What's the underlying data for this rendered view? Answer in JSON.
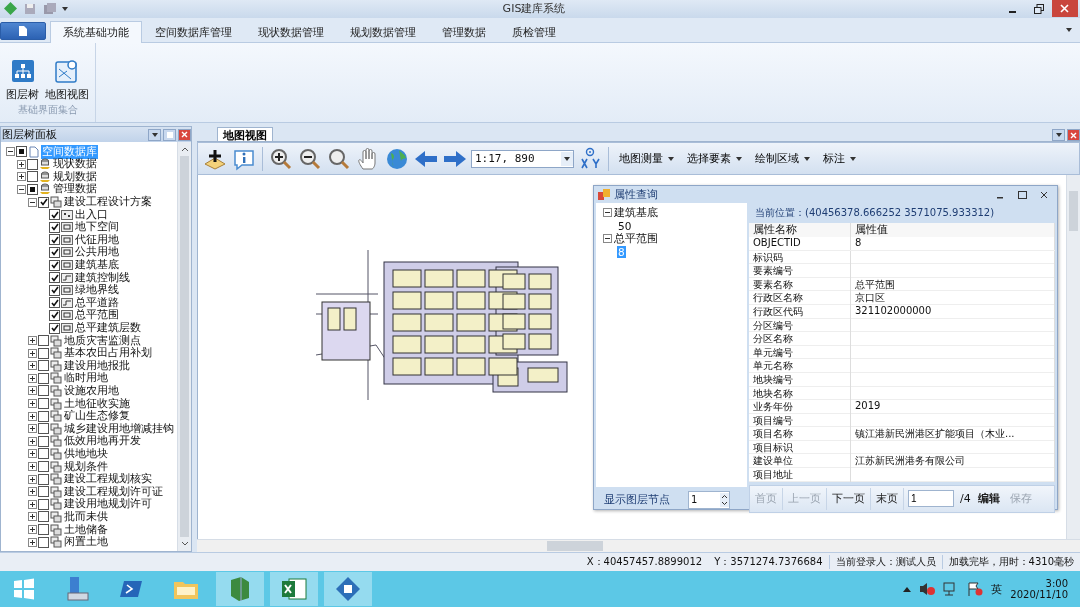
{
  "window": {
    "title": "GIS建库系统"
  },
  "ribbon": {
    "tabs": [
      {
        "label": "系统基础功能",
        "selected": true
      },
      {
        "label": "空间数据库管理",
        "selected": false
      },
      {
        "label": "现状数据管理",
        "selected": false
      },
      {
        "label": "规划数据管理",
        "selected": false
      },
      {
        "label": "管理数据",
        "selected": false
      },
      {
        "label": "质检管理",
        "selected": false
      }
    ],
    "group": {
      "label": "基础界面集合",
      "buttons": [
        {
          "label": "图层树",
          "kind": "tree"
        },
        {
          "label": "地图视图",
          "kind": "map"
        }
      ]
    }
  },
  "layer_panel": {
    "title": "图层树面板",
    "tree": [
      {
        "label": "空间数据库",
        "kind": "root",
        "partial": true,
        "expanded": true,
        "selected": true,
        "children": [
          {
            "label": "现状数据",
            "kind": "database",
            "checked": false,
            "expanded": false,
            "selected": false
          },
          {
            "label": "规划数据",
            "kind": "database",
            "checked": false,
            "expanded": false,
            "selected": false
          },
          {
            "label": "管理数据",
            "kind": "database",
            "partial": true,
            "expanded": true,
            "selected": false,
            "children": [
              {
                "label": "建设工程设计方案",
                "kind": "group",
                "checked": true,
                "expanded": true,
                "selected": false,
                "children": [
                  {
                    "label": "出入口",
                    "kind": "point",
                    "checked": true,
                    "selected": false
                  },
                  {
                    "label": "地下空间",
                    "kind": "polygon",
                    "checked": true,
                    "selected": false
                  },
                  {
                    "label": "代征用地",
                    "kind": "polygon",
                    "checked": true,
                    "selected": false
                  },
                  {
                    "label": "公共用地",
                    "kind": "polygon",
                    "checked": true,
                    "selected": false
                  },
                  {
                    "label": "建筑基底",
                    "kind": "polygon",
                    "checked": true,
                    "selected": false
                  },
                  {
                    "label": "建筑控制线",
                    "kind": "line",
                    "checked": true,
                    "selected": false
                  },
                  {
                    "label": "绿地界线",
                    "kind": "polygon",
                    "checked": true,
                    "selected": false
                  },
                  {
                    "label": "总平道路",
                    "kind": "line",
                    "checked": true,
                    "selected": false
                  },
                  {
                    "label": "总平范围",
                    "kind": "polygon",
                    "checked": true,
                    "selected": false
                  },
                  {
                    "label": "总平建筑层数",
                    "kind": "polygon",
                    "checked": true,
                    "selected": false
                  }
                ]
              },
              {
                "label": "地质灾害监测点",
                "kind": "group",
                "checked": false,
                "expanded": false,
                "selected": false
              },
              {
                "label": "基本农田占用补划",
                "kind": "group",
                "checked": false,
                "expanded": false,
                "selected": false
              },
              {
                "label": "建设用地报批",
                "kind": "group",
                "checked": false,
                "expanded": false,
                "selected": false
              },
              {
                "label": "临时用地",
                "kind": "group",
                "checked": false,
                "expanded": false,
                "selected": false
              },
              {
                "label": "设施农用地",
                "kind": "group",
                "checked": false,
                "expanded": false,
                "selected": false
              },
              {
                "label": "土地征收实施",
                "kind": "group",
                "checked": false,
                "expanded": false,
                "selected": false
              },
              {
                "label": "矿山生态修复",
                "kind": "group",
                "checked": false,
                "expanded": false,
                "selected": false
              },
              {
                "label": "城乡建设用地增减挂钩",
                "kind": "group",
                "checked": false,
                "expanded": false,
                "selected": false
              },
              {
                "label": "低效用地再开发",
                "kind": "group",
                "checked": false,
                "expanded": false,
                "selected": false
              },
              {
                "label": "供地地块",
                "kind": "group",
                "checked": false,
                "expanded": false,
                "selected": false
              },
              {
                "label": "规划条件",
                "kind": "group",
                "checked": false,
                "expanded": false,
                "selected": false
              },
              {
                "label": "建设工程规划核实",
                "kind": "group",
                "checked": false,
                "expanded": false,
                "selected": false
              },
              {
                "label": "建设工程规划许可证",
                "kind": "group",
                "checked": false,
                "expanded": false,
                "selected": false
              },
              {
                "label": "建设用地规划许可",
                "kind": "group",
                "checked": false,
                "expanded": false,
                "selected": false
              },
              {
                "label": "批而未供",
                "kind": "group",
                "checked": false,
                "expanded": false,
                "selected": false
              },
              {
                "label": "土地储备",
                "kind": "group",
                "checked": false,
                "expanded": false,
                "selected": false
              },
              {
                "label": "闲置土地",
                "kind": "group",
                "checked": false,
                "expanded": false,
                "selected": false
              }
            ]
          }
        ]
      }
    ]
  },
  "map_view": {
    "tab": "地图视图",
    "scale": "1:17, 890",
    "menus": [
      "地图测量",
      "选择要素",
      "绘制区域",
      "标注"
    ]
  },
  "attribute_dialog": {
    "title": "属性查询",
    "tree": [
      {
        "label": "建筑基底",
        "expanded": true,
        "selected": false,
        "children": [
          {
            "label": "50",
            "selected": false
          }
        ]
      },
      {
        "label": "总平范围",
        "expanded": true,
        "selected": false,
        "children": [
          {
            "label": "8",
            "selected": true
          }
        ]
      }
    ],
    "node_label": "显示图层节点",
    "node_value": "1",
    "location": "当前位置：(40456378.666252  3571075.933312)",
    "columns": [
      "属性名称",
      "属性值"
    ],
    "rows": [
      {
        "name": "OBJECTID",
        "value": "8"
      },
      {
        "name": "标识码"
      },
      {
        "name": "要素编号"
      },
      {
        "name": "要素名称",
        "value": "总平范围"
      },
      {
        "name": "行政区名称",
        "value": "京口区"
      },
      {
        "name": "行政区代码",
        "value": "321102000000"
      },
      {
        "name": "分区编号"
      },
      {
        "name": "分区名称"
      },
      {
        "name": "单元编号"
      },
      {
        "name": "单元名称"
      },
      {
        "name": "地块编号"
      },
      {
        "name": "地块名称"
      },
      {
        "name": "业务年份",
        "value": "2019"
      },
      {
        "name": "项目编号"
      },
      {
        "name": "项目名称",
        "value": "镇江港新民洲港区扩能项目（木业..."
      },
      {
        "name": "项目标识"
      },
      {
        "name": "建设单位",
        "value": "江苏新民洲港务有限公司"
      },
      {
        "name": "项目地址"
      }
    ],
    "pager": [
      {
        "label": "首页",
        "disabled": true
      },
      {
        "label": "上一页",
        "disabled": true
      },
      {
        "label": "下一页",
        "disabled": false
      },
      {
        "label": "末页",
        "disabled": false
      }
    ],
    "page_value": "1",
    "page_total": "/4",
    "actions": [
      {
        "label": "编辑",
        "disabled": false
      },
      {
        "label": "保存",
        "disabled": true
      }
    ]
  },
  "status_bar": {
    "x": "X：40457457.8899012",
    "y": "Y：3571274.7376684",
    "user": "当前登录人：测试人员",
    "load": "加载完毕，用时：4310毫秒"
  },
  "taskbar": {
    "ime": "英",
    "time": "3:00",
    "date": "2020/11/10"
  }
}
